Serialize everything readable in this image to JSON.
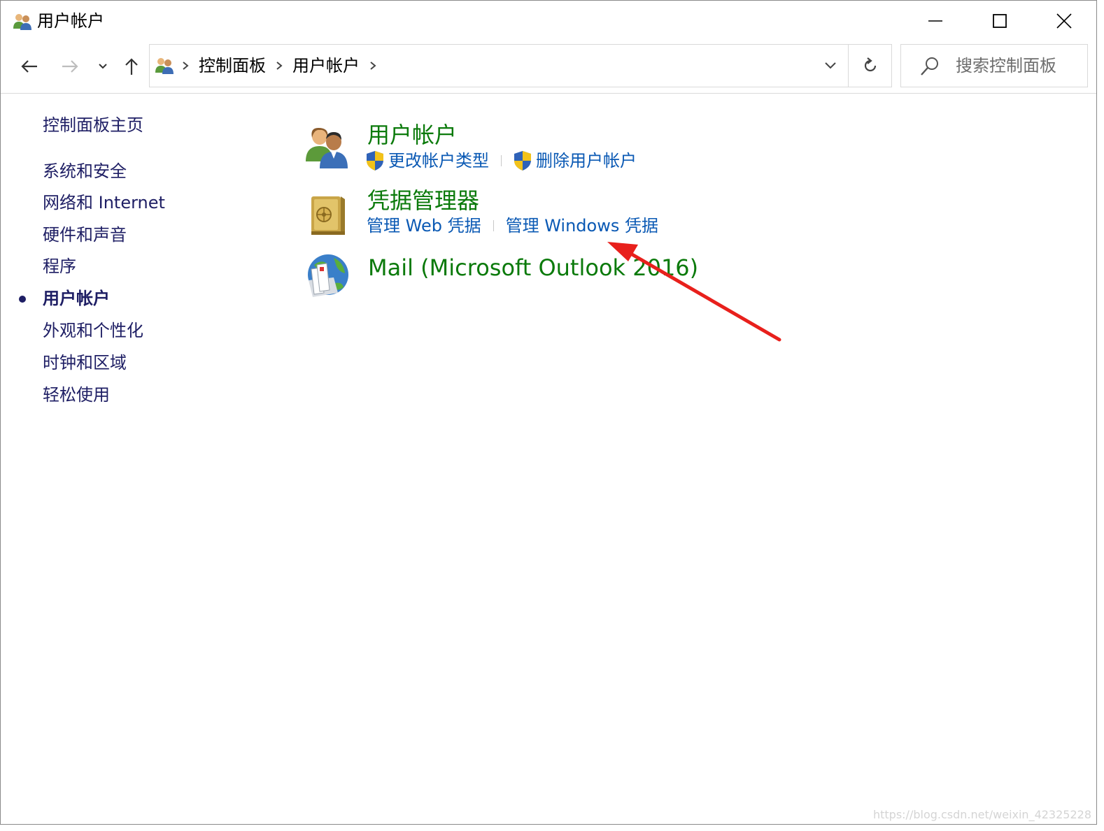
{
  "window": {
    "title": "用户帐户",
    "title_icon": "user-accounts-icon",
    "controls": {
      "minimize": "minimize-icon",
      "maximize": "maximize-icon",
      "close": "close-icon"
    }
  },
  "nav": {
    "back_icon": "arrow-left-icon",
    "forward_icon": "arrow-right-icon",
    "recent_icon": "chevron-down-icon",
    "up_icon": "arrow-up-icon",
    "breadcrumbs": [
      "控制面板",
      "用户帐户"
    ],
    "search_placeholder": "搜索控制面板"
  },
  "sidebar": {
    "home": "控制面板主页",
    "items": [
      {
        "label": "系统和安全",
        "active": false
      },
      {
        "label": "网络和 Internet",
        "active": false
      },
      {
        "label": "硬件和声音",
        "active": false
      },
      {
        "label": "程序",
        "active": false
      },
      {
        "label": "用户帐户",
        "active": true
      },
      {
        "label": "外观和个性化",
        "active": false
      },
      {
        "label": "时钟和区域",
        "active": false
      },
      {
        "label": "轻松使用",
        "active": false
      }
    ]
  },
  "sections": [
    {
      "title": "用户帐户",
      "icon": "users-icon",
      "links": [
        {
          "label": "更改帐户类型",
          "icon": "uac-shield-icon"
        },
        {
          "label": "删除用户帐户",
          "icon": "uac-shield-icon"
        }
      ]
    },
    {
      "title": "凭据管理器",
      "icon": "vault-icon",
      "links": [
        {
          "label": "管理 Web 凭据"
        },
        {
          "label": "管理 Windows 凭据"
        }
      ]
    },
    {
      "title": "Mail (Microsoft Outlook 2016)",
      "icon": "mail-globe-icon",
      "links": []
    }
  ],
  "annotation": {
    "type": "red-arrow",
    "color": "#e8201c",
    "points_to": "管理 Windows 凭据"
  },
  "colors": {
    "section_title": "#0b7a0b",
    "link": "#0a59b4",
    "sidebar_text": "#1e1e64"
  },
  "watermark": "https://blog.csdn.net/weixin_42325228"
}
